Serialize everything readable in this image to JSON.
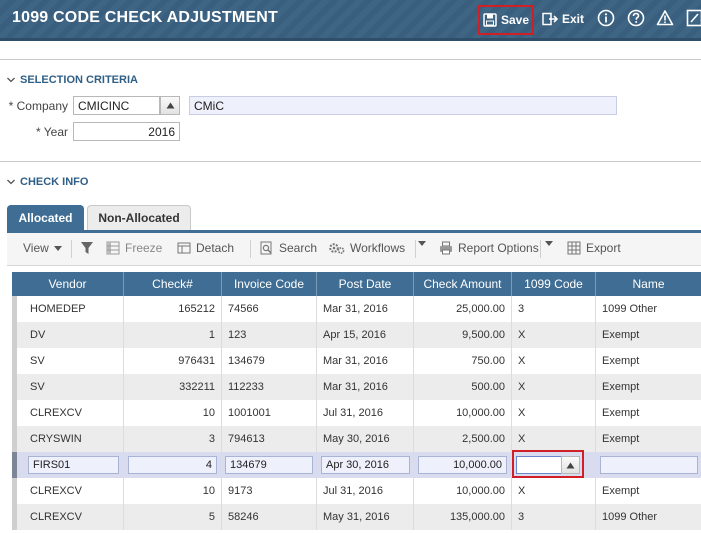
{
  "header": {
    "title": "1099 CODE CHECK ADJUSTMENT",
    "save_label": "Save",
    "exit_label": "Exit"
  },
  "selection": {
    "title": "SELECTION CRITERIA",
    "company_label": "* Company",
    "company_value": "CMICINC",
    "company_name": "CMiC",
    "year_label": "* Year",
    "year_value": "2016"
  },
  "checkinfo": {
    "title": "CHECK INFO"
  },
  "tabs": [
    {
      "label": "Allocated",
      "active": true
    },
    {
      "label": "Non-Allocated",
      "active": false
    }
  ],
  "toolbar": {
    "view": "View",
    "freeze": "Freeze",
    "detach": "Detach",
    "search": "Search",
    "workflows": "Workflows",
    "report_options": "Report Options",
    "export": "Export"
  },
  "grid": {
    "columns": [
      "Vendor",
      "Check#",
      "Invoice Code",
      "Post Date",
      "Check Amount",
      "1099 Code",
      "Name"
    ],
    "rows": [
      [
        "HOMEDEP",
        "165212",
        "74566",
        "Mar 31, 2016",
        "25,000.00",
        "3",
        "1099 Other"
      ],
      [
        "DV",
        "1",
        "123",
        "Apr 15, 2016",
        "9,500.00",
        "X",
        "Exempt"
      ],
      [
        "SV",
        "976431",
        "134679",
        "Mar 31, 2016",
        "750.00",
        "X",
        "Exempt"
      ],
      [
        "SV",
        "332211",
        "112233",
        "Mar 31, 2016",
        "500.00",
        "X",
        "Exempt"
      ],
      [
        "CLREXCV",
        "10",
        "1001001",
        "Jul 31, 2016",
        "10,000.00",
        "X",
        "Exempt"
      ],
      [
        "CRYSWIN",
        "3",
        "794613",
        "May 30, 2016",
        "2,500.00",
        "X",
        "Exempt"
      ],
      [
        "FIRS01",
        "4",
        "134679",
        "Apr 30, 2016",
        "10,000.00",
        "",
        ""
      ],
      [
        "CLREXCV",
        "10",
        "9173",
        "Jul 31, 2016",
        "10,000.00",
        "X",
        "Exempt"
      ],
      [
        "CLREXCV",
        "5",
        "58246",
        "May 31, 2016",
        "135,000.00",
        "3",
        "1099 Other"
      ]
    ]
  }
}
